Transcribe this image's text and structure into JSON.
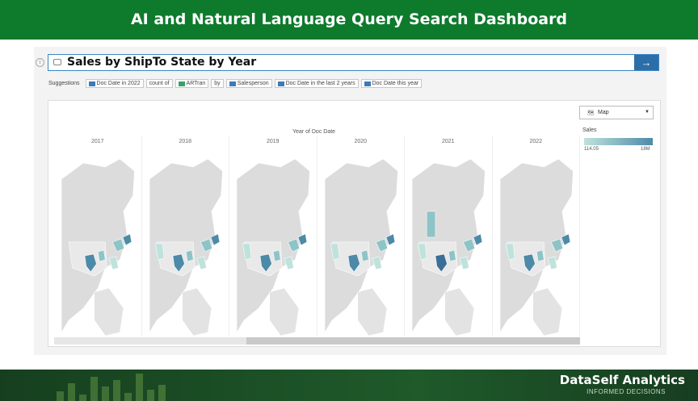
{
  "banner": {
    "title": "AI and Natural Language Query Search Dashboard"
  },
  "search": {
    "query": "Sales by ShipTo State by Year",
    "go_label": "→"
  },
  "suggestions": {
    "label": "Suggestions",
    "chips": [
      {
        "text": "Doc Date in 2022",
        "icon": "calendar-icon"
      },
      {
        "text": "count of",
        "icon": ""
      },
      {
        "text": "ARTran",
        "icon": "table-icon"
      },
      {
        "text": "by",
        "icon": ""
      },
      {
        "text": "Salesperson",
        "icon": "field-icon"
      },
      {
        "text": "Doc Date in the last 2 years",
        "icon": "calendar-icon"
      },
      {
        "text": "Doc Date this year",
        "icon": "calendar-icon"
      }
    ]
  },
  "viz": {
    "mark_type": "Map",
    "axis_title": "Year of Doc Date",
    "years": [
      "2017",
      "2018",
      "2019",
      "2020",
      "2021",
      "2022"
    ]
  },
  "legend": {
    "title": "Sales",
    "min": "114.05",
    "max": "18M",
    "color_low": "#bfe3dc",
    "color_high": "#4d8aa8"
  },
  "footer": {
    "brand": "DataSelf Analytics",
    "tagline": "INFORMED DECISIONS"
  },
  "colors": {
    "banner": "#0e7a2c",
    "accent": "#2b6ea8"
  }
}
